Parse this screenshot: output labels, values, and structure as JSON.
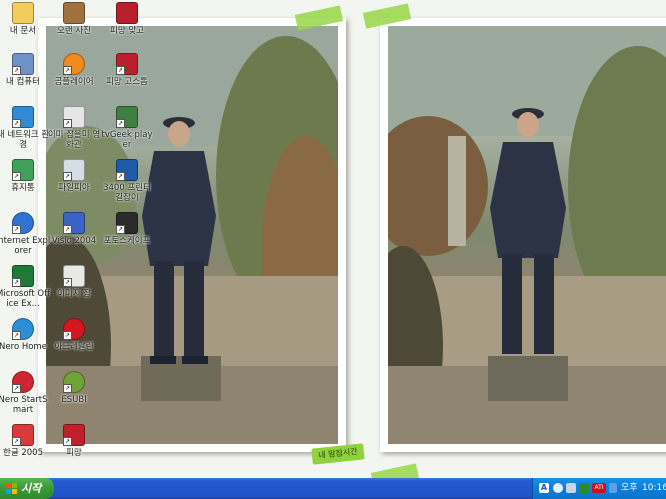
{
  "desktop": {
    "caption": "내 맘잠시간",
    "icons": [
      {
        "label": "내 문서",
        "icon": "my-documents-icon"
      },
      {
        "label": "오랜 사진",
        "icon": "photo-album-icon"
      },
      {
        "label": "피망 맞고",
        "icon": "pmang-gostop-icon"
      },
      {
        "label": "내 컴퓨터",
        "icon": "my-computer-icon"
      },
      {
        "label": "곰플레이어",
        "icon": "gom-player-icon"
      },
      {
        "label": "피망 고스톱",
        "icon": "pmang-gostop2-icon"
      },
      {
        "label": "내 네트워크 환경",
        "icon": "network-places-icon"
      },
      {
        "label": "이미 잡을미 영화관",
        "icon": "movie-file-icon"
      },
      {
        "label": "tvGeek player",
        "icon": "tv-player-icon"
      },
      {
        "label": "휴지통",
        "icon": "recycle-bin-icon"
      },
      {
        "label": "파일피아",
        "icon": "filepia-icon"
      },
      {
        "label": "3400 프린터 길잡이",
        "icon": "hp-printer-icon"
      },
      {
        "label": "Internet Explorer",
        "icon": "internet-explorer-icon"
      },
      {
        "label": "Visio 2004",
        "icon": "visio-icon"
      },
      {
        "label": "포토스케이프",
        "icon": "photoscape-icon"
      },
      {
        "label": "Microsoft Office Ex...",
        "icon": "excel-icon"
      },
      {
        "label": "이미지 잡",
        "icon": "image-tool-icon"
      },
      {
        "label": "",
        "icon": ""
      },
      {
        "label": "Nero Home",
        "icon": "nero-home-icon"
      },
      {
        "label": "아드레날린",
        "icon": "adrenalin-icon"
      },
      {
        "label": "",
        "icon": ""
      },
      {
        "label": "Nero StartSmart",
        "icon": "nero-startsmart-icon"
      },
      {
        "label": "ESUBI",
        "icon": "esubi-icon"
      },
      {
        "label": "",
        "icon": ""
      },
      {
        "label": "한글 2005",
        "icon": "hangul-icon"
      },
      {
        "label": "피망",
        "icon": "pmang-icon"
      }
    ]
  },
  "taskbar": {
    "start_label": "시작",
    "tray_icons": [
      "language-bar-icon",
      "volume-icon",
      "network-icon",
      "security-icon",
      "ati-icon"
    ],
    "ampm": "오후",
    "clock": "10:16"
  },
  "colors": {
    "taskbar": "#2154c8",
    "start_button": "#3c9a37",
    "tape": "#96d746"
  }
}
